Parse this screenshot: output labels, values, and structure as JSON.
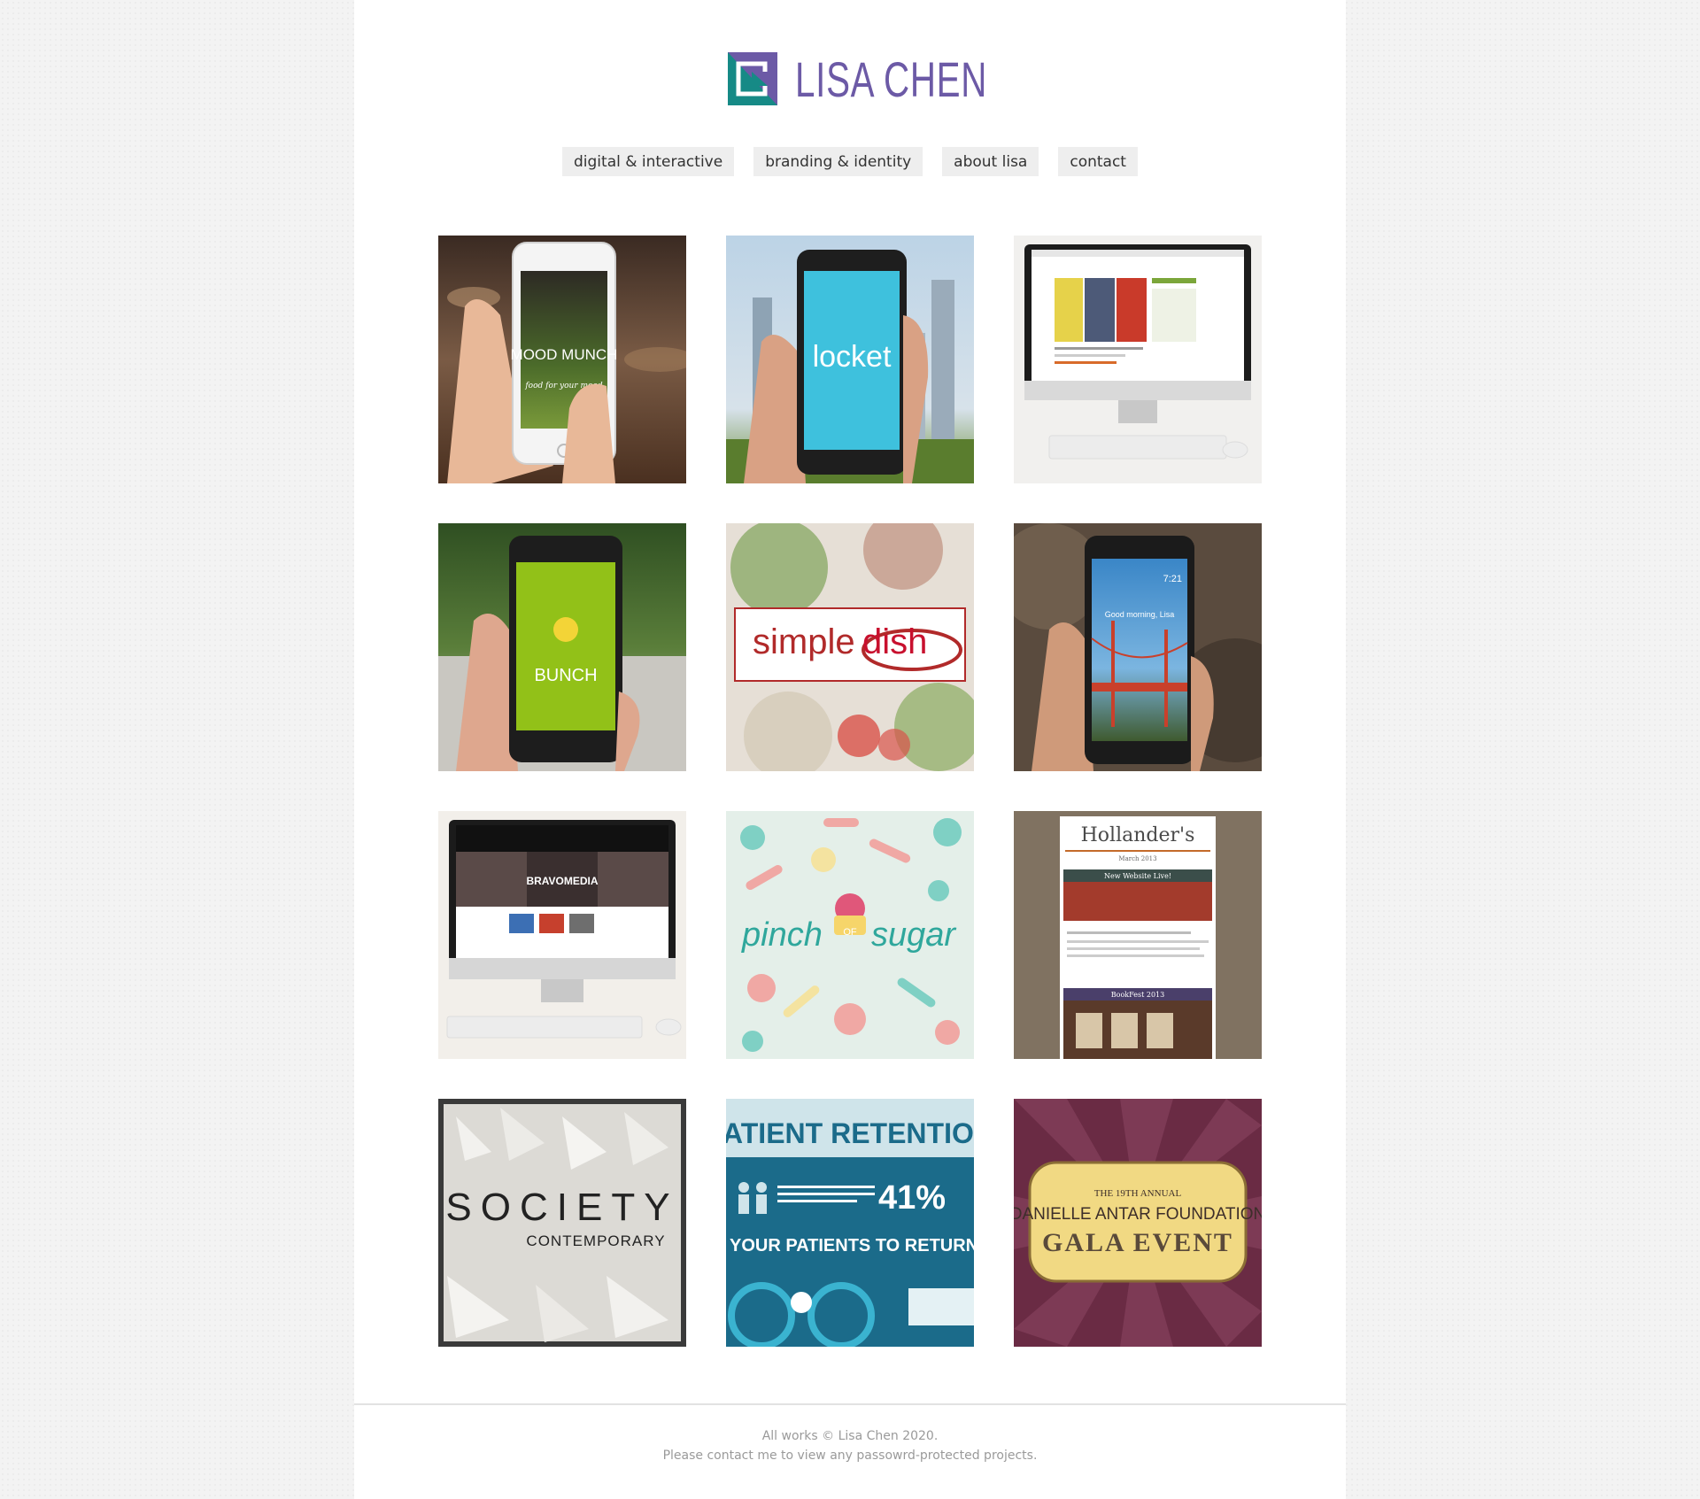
{
  "header": {
    "logo_text": "LISA CHEN",
    "logo_icon": "lc-square-logo-icon"
  },
  "nav": {
    "items": [
      {
        "label": "digital & interactive"
      },
      {
        "label": "branding & identity"
      },
      {
        "label": "about lisa"
      },
      {
        "label": "contact"
      }
    ]
  },
  "portfolio": {
    "tiles": [
      {
        "name": "mood-munch",
        "screen_text": "MOOD MUNCH",
        "tagline": "food for your mood"
      },
      {
        "name": "locket",
        "screen_text": "locket"
      },
      {
        "name": "simpledish-website"
      },
      {
        "name": "bunch",
        "screen_text": "BUNCH"
      },
      {
        "name": "simpledish",
        "word_a": "simple",
        "word_b": "dish"
      },
      {
        "name": "lockscreen",
        "time": "7:21",
        "greeting": "Good morning, Lisa"
      },
      {
        "name": "sequel-website",
        "slide_text": "BRAVOMEDIA"
      },
      {
        "name": "pinch-of-sugar",
        "word_a": "pinch",
        "word_mid": "OF",
        "word_b": "sugar"
      },
      {
        "name": "hollanders",
        "title": "Hollander's",
        "date": "March 2013",
        "banner_1": "New Website Live!",
        "banner_2": "BookFest 2013"
      },
      {
        "name": "society-contemporary",
        "line_1": "SOCIETY",
        "line_2": "CONTEMPORARY"
      },
      {
        "name": "patient-retention",
        "headline": "PATIENT RETENTION",
        "stat": "41%",
        "question": "YOUR PATIENTS TO RETURN?"
      },
      {
        "name": "gala-event",
        "line_1": "THE 19TH ANNUAL",
        "line_2": "DANIELLE ANTAR FOUNDATION",
        "line_3": "GALA EVENT"
      }
    ]
  },
  "footer": {
    "line1": "All works © Lisa Chen 2020.",
    "line2": "Please contact me to view any passowrd-protected projects."
  },
  "colors": {
    "logo_purple": "#6c5aa6",
    "logo_teal": "#168a86",
    "page_bg": "#f3f3f3",
    "nav_bg": "#eeeeee"
  }
}
